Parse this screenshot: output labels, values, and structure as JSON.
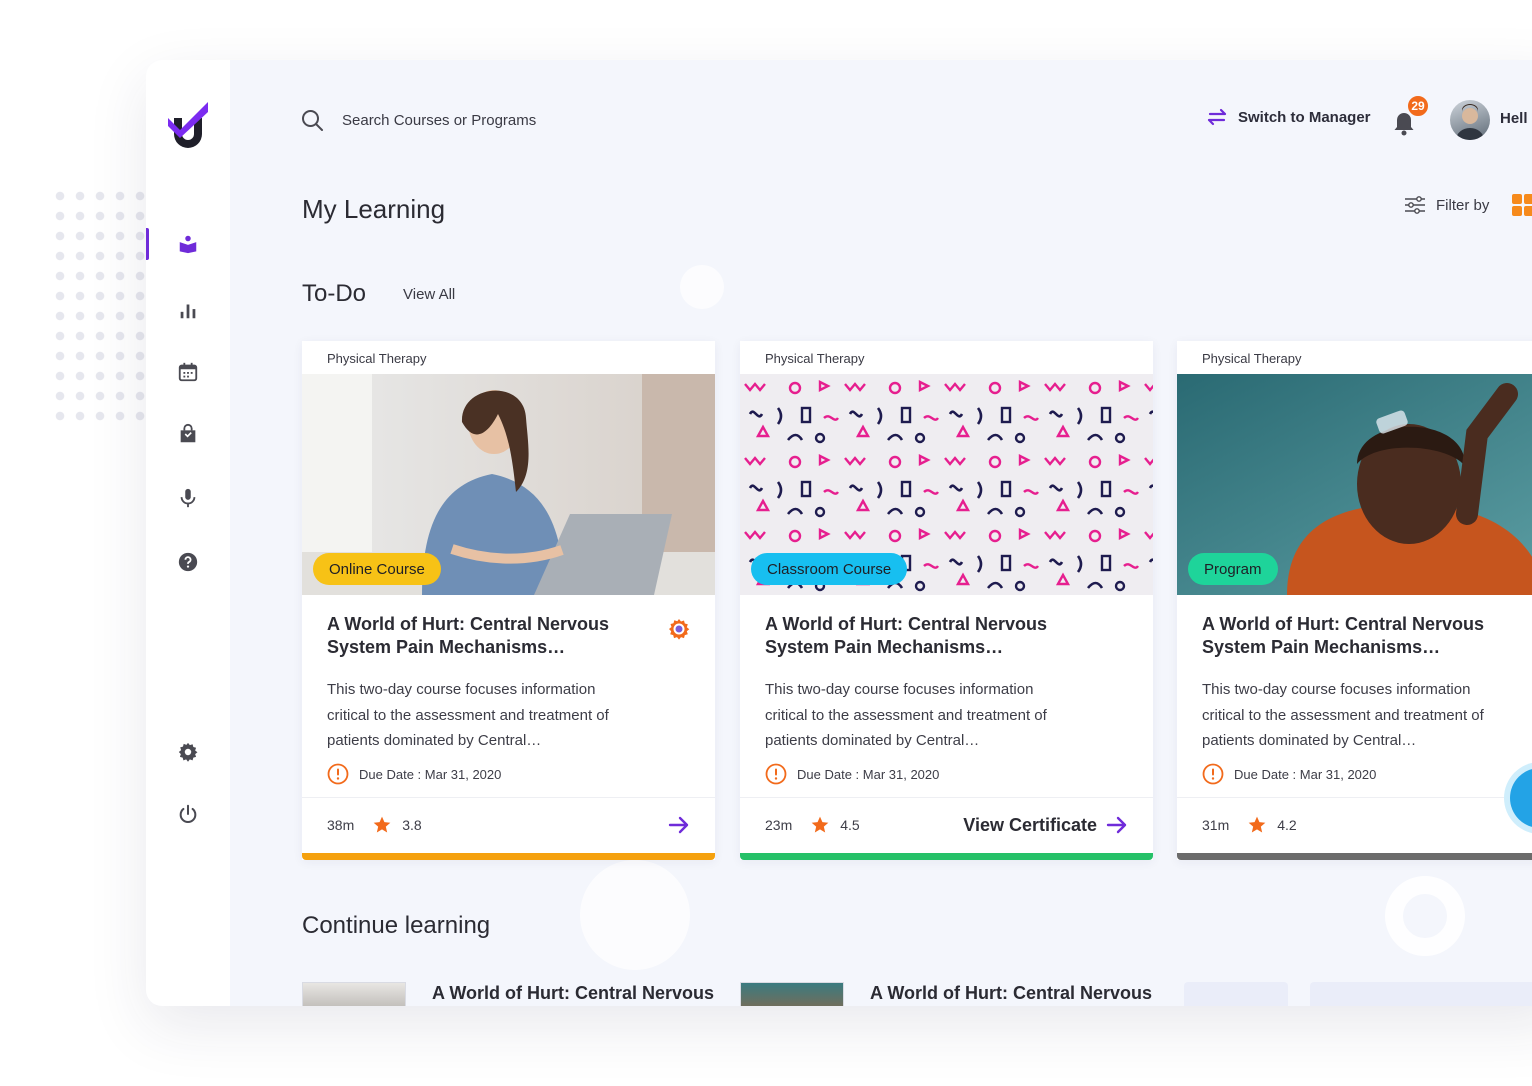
{
  "search": {
    "placeholder": "Search Courses or Programs"
  },
  "header": {
    "switch_label": "Switch to Manager",
    "notification_count": "29",
    "greeting": "Hell"
  },
  "page": {
    "title": "My Learning",
    "filter_label": "Filter by"
  },
  "todo": {
    "title": "To-Do",
    "view_all": "View All",
    "cards": [
      {
        "category": "Physical Therapy",
        "type": "Online Course",
        "type_color": "#f7c216",
        "title": "A World of Hurt: Central Nervous System Pain Mechanisms…",
        "description": "This two-day course focuses information critical to the assessment and treatment of patients dominated by Central…",
        "due": "Due Date : Mar 31, 2020",
        "duration": "38m",
        "rating": "3.8",
        "bar_color": "#f5a10e"
      },
      {
        "category": "Physical Therapy",
        "type": "Classroom Course",
        "type_color": "#17bff0",
        "title": "A World of Hurt: Central Nervous System Pain Mechanisms…",
        "description": "This two-day course focuses information critical to the assessment and treatment of patients dominated by Central…",
        "due": "Due Date : Mar 31, 2020",
        "duration": "23m",
        "rating": "4.5",
        "action": "View Certificate",
        "bar_color": "#25c168"
      },
      {
        "category": "Physical Therapy",
        "type": "Program",
        "type_color": "#1ed49a",
        "title": "A World of Hurt: Central Nervous System Pain Mechanisms…",
        "description": "This two-day course focuses information critical to the assessment and treatment of patients dominated by Central…",
        "due": "Due Date : Mar 31, 2020",
        "duration": "31m",
        "rating": "4.2",
        "bar_color": "#6b6b6b"
      }
    ]
  },
  "continue": {
    "title": "Continue learning",
    "items": [
      {
        "title": "A World of Hurt: Central Nervous System Pain Mechanisms…"
      },
      {
        "title": "A World of Hurt: Central Nervous System Pain Mechanisms…"
      }
    ]
  },
  "colors": {
    "accent": "#6f2bd9",
    "brand_orange": "#f26a1b",
    "star": "#f26a1b"
  }
}
